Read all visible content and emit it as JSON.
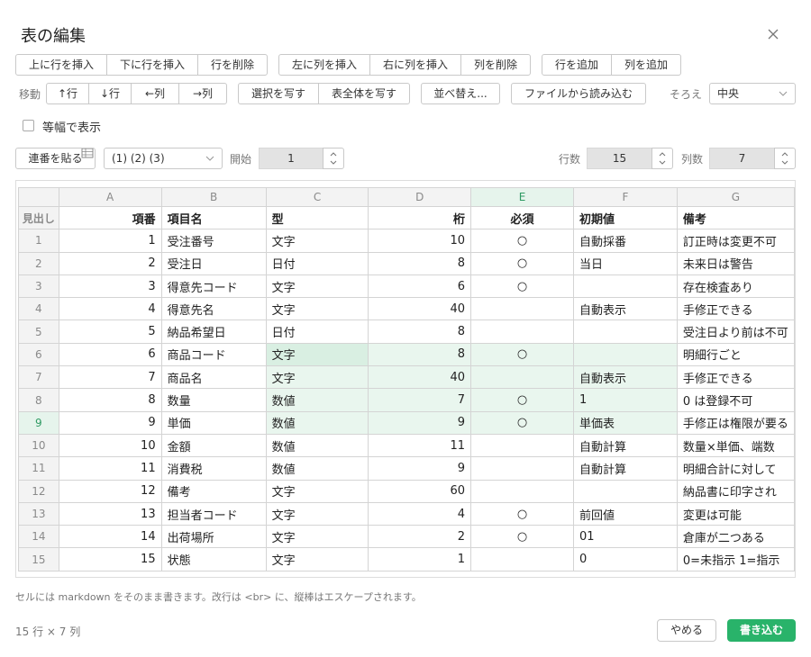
{
  "dialog": {
    "title": "表の編集"
  },
  "row_ops": {
    "insert_above": "上に行を挿入",
    "insert_below": "下に行を挿入",
    "delete_row": "行を削除"
  },
  "col_ops": {
    "insert_left": "左に列を挿入",
    "insert_right": "右に列を挿入",
    "delete_col": "列を削除"
  },
  "add_ops": {
    "add_row": "行を追加",
    "add_col": "列を追加"
  },
  "move": {
    "label": "移動",
    "up": "↑行",
    "down": "↓行",
    "left": "←列",
    "right": "→列"
  },
  "copy": {
    "selection": "選択を写す",
    "whole": "表全体を写す"
  },
  "sort_label": "並べ替え...",
  "import_label": "ファイルから読み込む",
  "align": {
    "label": "そろえ",
    "value": "中央"
  },
  "monospace": {
    "label": "等幅で表示",
    "checked": false
  },
  "numbering": {
    "paste_label": "連番を貼る",
    "format": "(1) (2) (3)",
    "start_label": "開始",
    "start_value": "1"
  },
  "rows": {
    "label": "行数",
    "value": "15"
  },
  "cols": {
    "label": "列数",
    "value": "7"
  },
  "grid": {
    "col_letters": [
      "A",
      "B",
      "C",
      "D",
      "E",
      "F",
      "G"
    ],
    "header_row_label": "見出し",
    "headers": [
      "項番",
      "項目名",
      "型",
      "桁",
      "必須",
      "初期値",
      "備考"
    ],
    "rows": [
      [
        "1",
        "受注番号",
        "文字",
        "10",
        "○",
        "自動採番",
        "訂正時は変更不可"
      ],
      [
        "2",
        "受注日",
        "日付",
        "8",
        "○",
        "当日",
        "未来日は警告"
      ],
      [
        "3",
        "得意先コード",
        "文字",
        "6",
        "○",
        "",
        "存在検査あり"
      ],
      [
        "4",
        "得意先名",
        "文字",
        "40",
        "",
        "自動表示",
        "手修正できる"
      ],
      [
        "5",
        "納品希望日",
        "日付",
        "8",
        "",
        "",
        "受注日より前は不可"
      ],
      [
        "6",
        "商品コード",
        "文字",
        "8",
        "○",
        "",
        "明細行ごと"
      ],
      [
        "7",
        "商品名",
        "文字",
        "40",
        "",
        "自動表示",
        "手修正できる"
      ],
      [
        "8",
        "数量",
        "数値",
        "7",
        "○",
        "1",
        "0 は登録不可"
      ],
      [
        "9",
        "単価",
        "数値",
        "9",
        "○",
        "単価表",
        "手修正は権限が要る"
      ],
      [
        "10",
        "金額",
        "数値",
        "11",
        "",
        "自動計算",
        "数量×単価、端数"
      ],
      [
        "11",
        "消費税",
        "数値",
        "9",
        "",
        "自動計算",
        "明細合計に対して"
      ],
      [
        "12",
        "備考",
        "文字",
        "60",
        "",
        "",
        "納品書に印字され"
      ],
      [
        "13",
        "担当者コード",
        "文字",
        "4",
        "○",
        "前回値",
        "変更は可能"
      ],
      [
        "14",
        "出荷場所",
        "文字",
        "2",
        "○",
        "01",
        "倉庫が二つある"
      ],
      [
        "15",
        "状態",
        "文字",
        "1",
        "",
        "0",
        "0=未指示 1=指示"
      ]
    ],
    "selected_col": "E",
    "selected_row": "9"
  },
  "hint": "セルには markdown をそのまま書きます。改行は <br> に、縦棒はエスケープされます。",
  "footer": {
    "dims": "15 行 × 7 列",
    "cancel": "やめる",
    "write": "書き込む"
  },
  "colors": {
    "accent": "#29b36a",
    "selection": "#e9f6ee"
  }
}
